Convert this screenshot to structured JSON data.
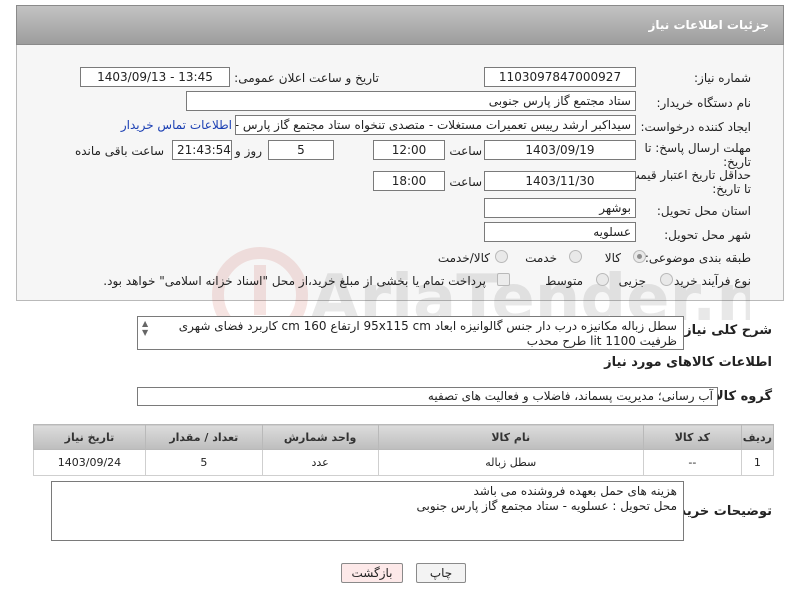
{
  "header": {
    "title": "جزئیات اطلاعات نیاز"
  },
  "fields": {
    "need_number_label": "شماره نیاز:",
    "need_number": "1103097847000927",
    "announce_label": "تاریخ و ساعت اعلان عمومی:",
    "announce_value": "1403/09/13 - 13:45",
    "buyer_org_label": "نام دستگاه خریدار:",
    "buyer_org": "ستاد مجتمع گاز پارس جنوبی",
    "creator_label": "ایجاد کننده درخواست:",
    "creator": "سیداکبر ارشد رییس تعمیرات مستغلات - متصدی تنخواه ستاد مجتمع گاز پارس -",
    "buyer_contact_link": "اطلاعات تماس خریدار",
    "deadline_label": "مهلت ارسال پاسخ: تا تاریخ:",
    "deadline_date": "1403/09/19",
    "time_label": "ساعت",
    "deadline_time": "12:00",
    "days_value": "5",
    "days_label": "روز و",
    "remaining_time": "21:43:54",
    "remaining_label": "ساعت باقی مانده",
    "validity_label": "حداقل تاریخ اعتبار قیمت: تا تاریخ:",
    "validity_date": "1403/11/30",
    "validity_time": "18:00",
    "province_label": "استان محل تحویل:",
    "province": "بوشهر",
    "city_label": "شهر محل تحویل:",
    "city": "عسلویه",
    "category_label": "طبقه بندی موضوعی:",
    "category_options": [
      "کالا",
      "خدمت",
      "کالا/خدمت"
    ],
    "process_label": "نوع فرآیند خرید :",
    "process_options": [
      "جزیی",
      "متوسط"
    ],
    "payment_note": "پرداخت تمام یا بخشی از مبلغ خرید،از محل \"اسناد خزانه اسلامی\" خواهد بود."
  },
  "description": {
    "label": "شرح کلی نیاز:",
    "text": "سطل زباله مکانیزه درب دار جنس گالوانیزه ابعاد 95x115 cm ارتفاع 160 cm کاربرد فضای شهری ظرفیت 1100 lit طرح محدب"
  },
  "goods": {
    "section_title": "اطلاعات کالاهای مورد نیاز",
    "group_label": "گروه کالا:",
    "group_value": "آب رسانی؛ مدیریت پسماند، فاضلاب و فعالیت های تصفیه"
  },
  "table": {
    "headers": [
      "ردیف",
      "کد کالا",
      "نام کالا",
      "واحد شمارش",
      "تعداد / مقدار",
      "تاریخ نیاز"
    ],
    "rows": [
      [
        "1",
        "--",
        "سطل زباله",
        "عدد",
        "5",
        "1403/09/24"
      ]
    ]
  },
  "buyer_notes": {
    "label": "توضیحات خریدار:",
    "line1": "هزینه های حمل بعهده فروشنده می باشد",
    "line2": "محل تحویل : عسلویه - ستاد مجتمع گاز پارس جنوبی"
  },
  "buttons": {
    "print": "چاپ",
    "back": "بازگشت"
  },
  "watermark": "AriaTender.neT",
  "colors": {
    "header": "#a9a9a9",
    "link": "#1b3fb3",
    "back_button": "#fde9e9"
  }
}
